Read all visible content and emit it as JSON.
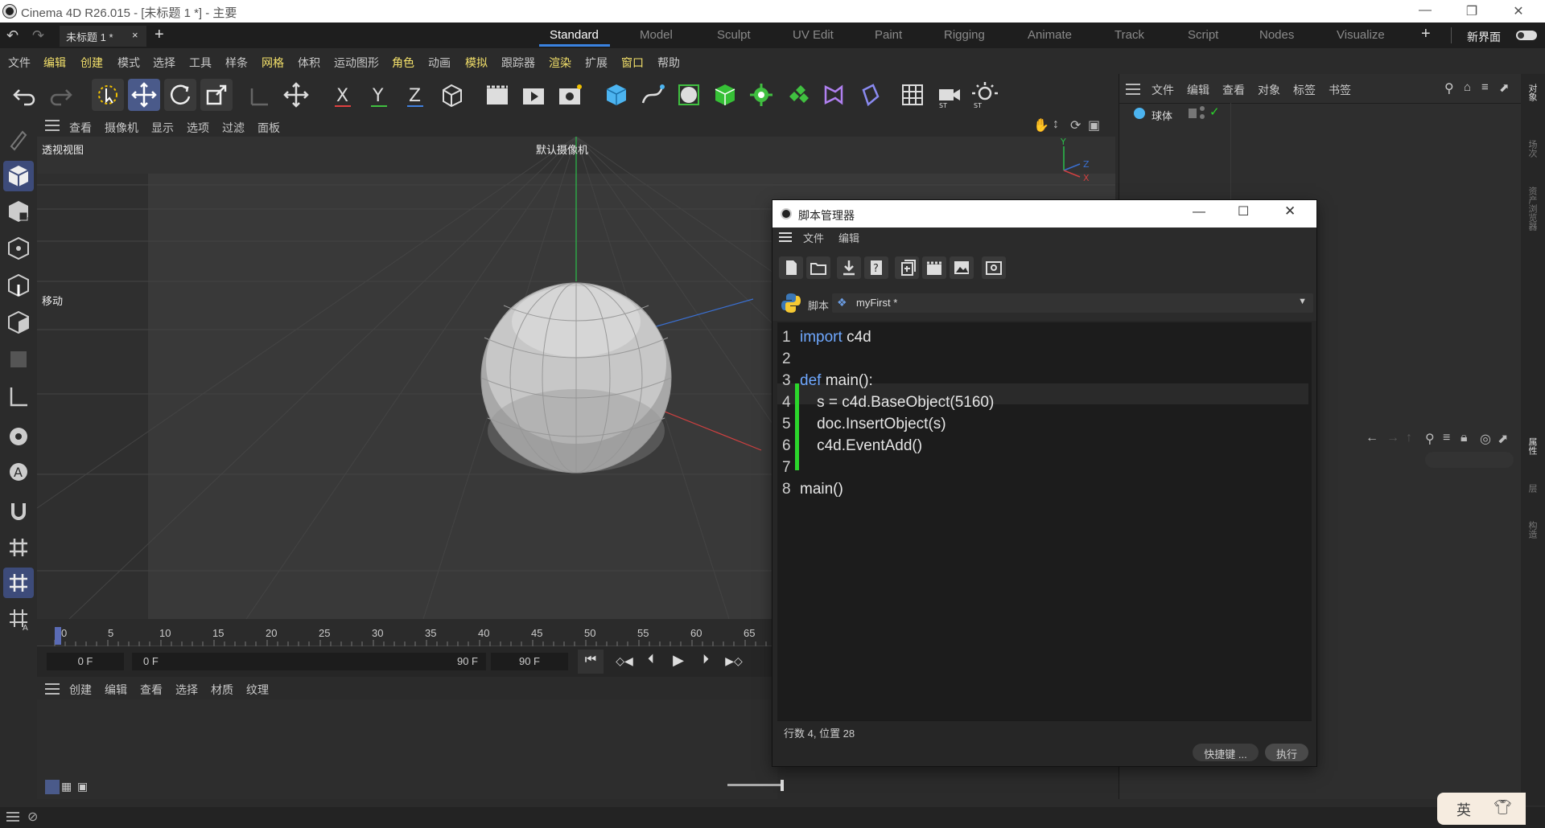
{
  "window": {
    "title": "Cinema 4D R26.015 - [未标题 1 *] - 主要"
  },
  "tabs": {
    "document_tab": "未标题 1 *",
    "layouts": [
      "Standard",
      "Model",
      "Sculpt",
      "UV Edit",
      "Paint",
      "Rigging",
      "Animate",
      "Track",
      "Script",
      "Nodes",
      "Visualize"
    ],
    "active_layout": "Standard",
    "new_layout": "新界面"
  },
  "menubar": [
    "文件",
    "编辑",
    "创建",
    "模式",
    "选择",
    "工具",
    "样条",
    "网格",
    "体积",
    "运动图形",
    "角色",
    "动画",
    "模拟",
    "跟踪器",
    "渲染",
    "扩展",
    "窗口",
    "帮助"
  ],
  "viewport": {
    "menu": [
      "查看",
      "摄像机",
      "显示",
      "选项",
      "过滤",
      "面板"
    ],
    "label": "透视视图",
    "camera": "默认摄像机",
    "tool_hint": "移动"
  },
  "timeline": {
    "ticks": [
      "0",
      "5",
      "10",
      "15",
      "20",
      "25",
      "30",
      "35",
      "40",
      "45",
      "50",
      "55",
      "60",
      "65"
    ],
    "current_frame": "0 F",
    "range_start": "0 F",
    "range_end": "90 F",
    "max_frame": "90 F"
  },
  "material_manager": {
    "menu": [
      "创建",
      "编辑",
      "查看",
      "选择",
      "材质",
      "纹理"
    ]
  },
  "object_manager": {
    "menu": [
      "文件",
      "编辑",
      "查看",
      "对象",
      "标签",
      "书签"
    ],
    "objects": [
      {
        "name": "球体"
      }
    ]
  },
  "right_strip": {
    "tabs": [
      "对象",
      "场次",
      "资产浏览器",
      "属性",
      "层",
      "构造"
    ]
  },
  "script_manager": {
    "title": "脚本管理器",
    "menu": [
      "文件",
      "编辑"
    ],
    "script_label": "脚本",
    "script_name": "myFirst *",
    "code_lines": [
      {
        "num": "1",
        "kw": "import",
        "text": " c4d"
      },
      {
        "num": "2",
        "kw": "",
        "text": ""
      },
      {
        "num": "3",
        "kw": "def",
        "text": " main():"
      },
      {
        "num": "4",
        "kw": "",
        "text": "    s = c4d.BaseObject(5160)"
      },
      {
        "num": "5",
        "kw": "",
        "text": "    doc.InsertObject(s)"
      },
      {
        "num": "6",
        "kw": "",
        "text": "    c4d.EventAdd()"
      },
      {
        "num": "7",
        "kw": "",
        "text": ""
      },
      {
        "num": "8",
        "kw": "",
        "text": "main()"
      }
    ],
    "status": "行数 4, 位置 28",
    "shortcut_button": "快捷键 ...",
    "execute_button": "执行"
  },
  "ime": {
    "label": "英"
  },
  "colors": {
    "accent": "#3a82e0",
    "highlight_menu": "#f3e06a",
    "change_bar": "#2bd62b"
  }
}
